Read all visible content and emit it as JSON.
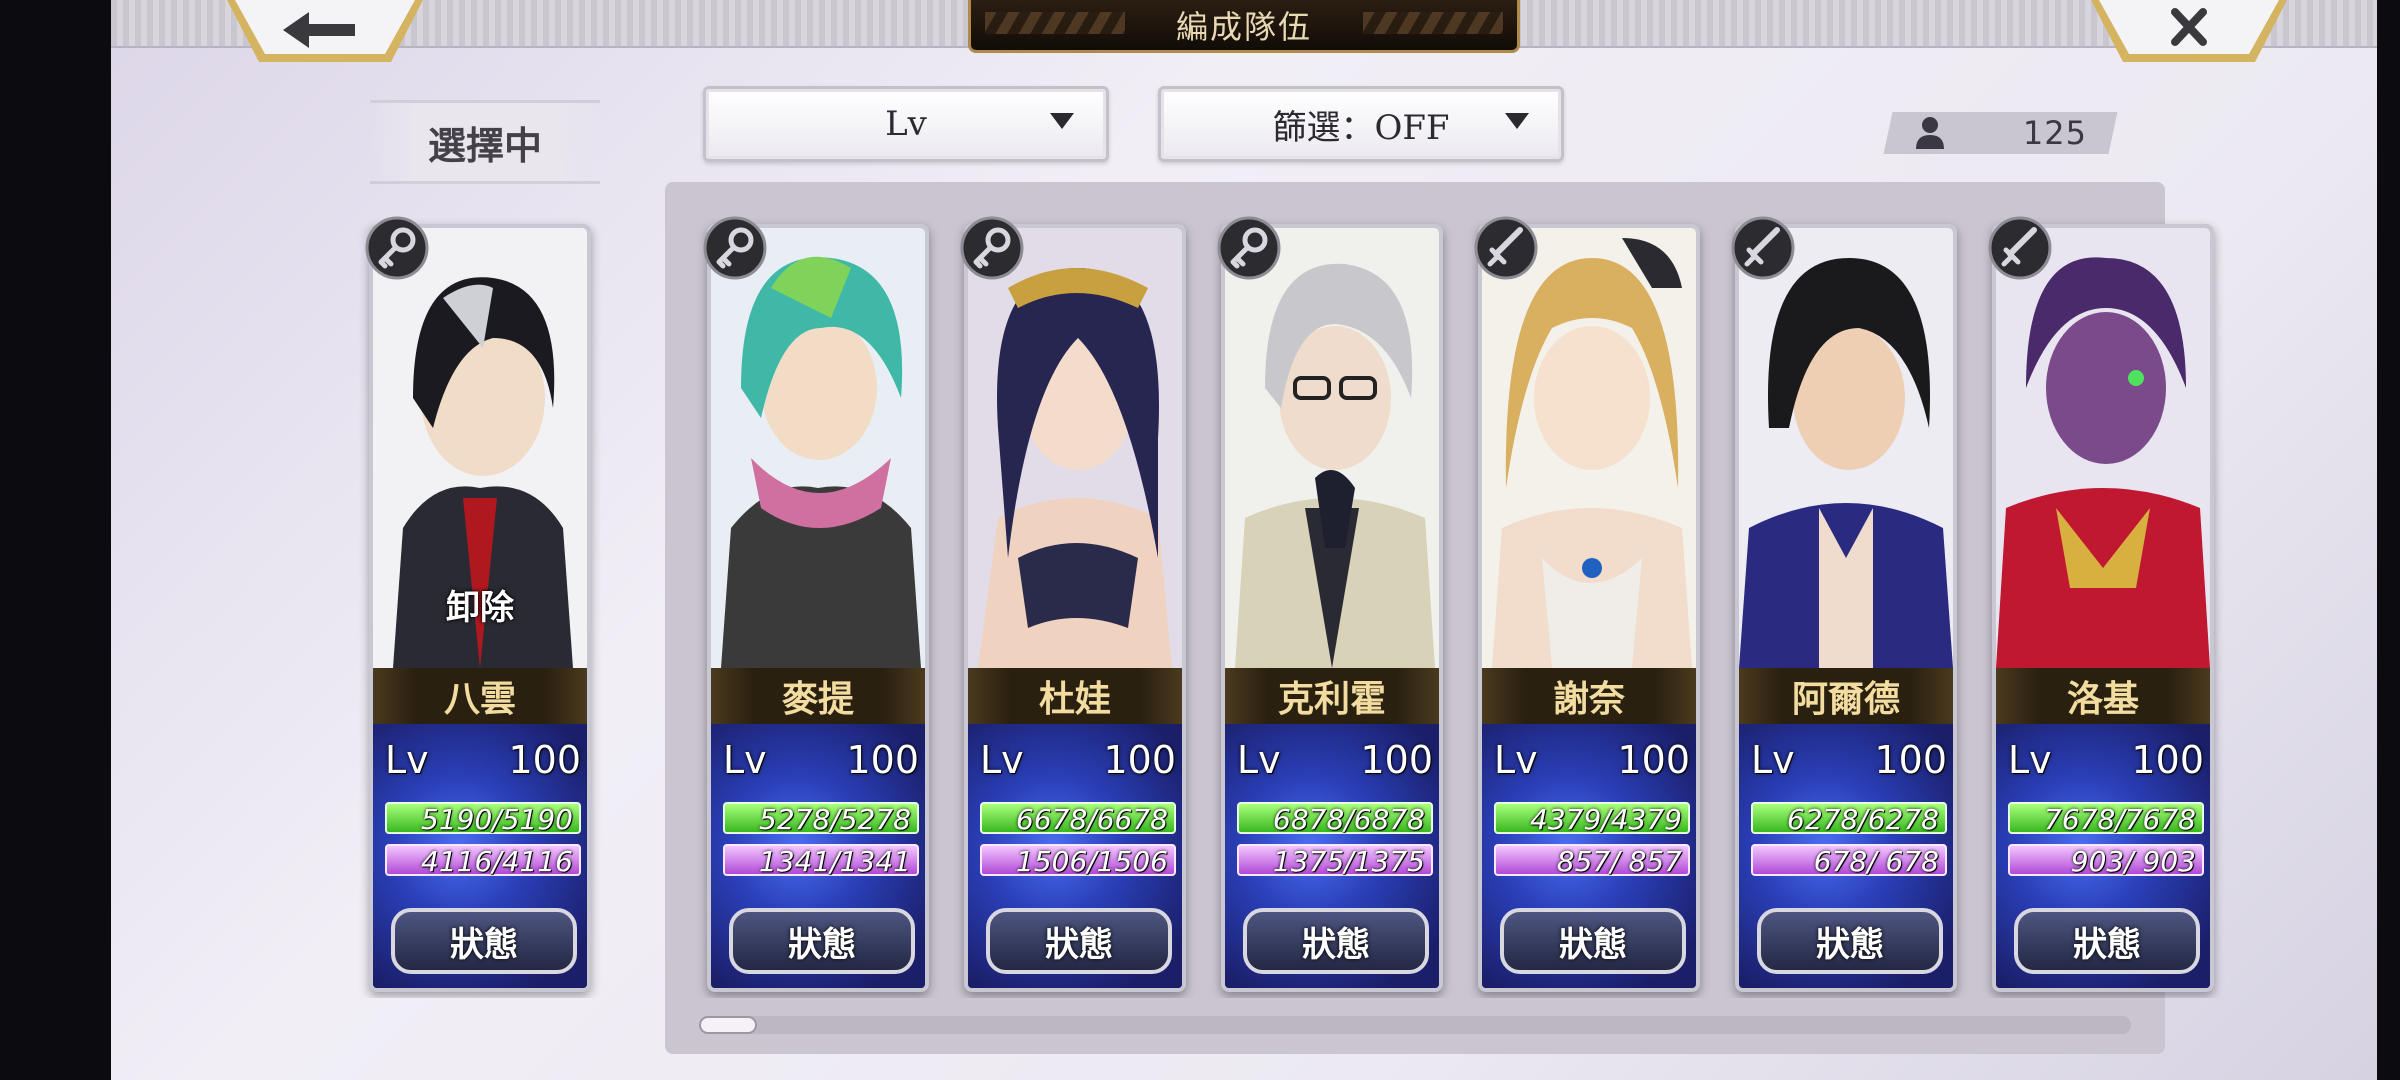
{
  "header": {
    "title": "編成隊伍"
  },
  "selected_label": "選擇中",
  "sort_dropdown": {
    "value": "Lv"
  },
  "filter_dropdown": {
    "value": "篩選：OFF"
  },
  "unit_count": "125",
  "remove_label": "卸除",
  "status_label": "狀態",
  "lv_label": "Lv",
  "selected_unit": {
    "name": "八雲",
    "level": "100",
    "hp": "5190/5190",
    "mp": "4116/4116",
    "role": "key"
  },
  "units": [
    {
      "name": "麥提",
      "level": "100",
      "hp": "5278/5278",
      "mp": "1341/1341",
      "role": "key"
    },
    {
      "name": "杜娃",
      "level": "100",
      "hp": "6678/6678",
      "mp": "1506/1506",
      "role": "key"
    },
    {
      "name": "克利霍",
      "level": "100",
      "hp": "6878/6878",
      "mp": "1375/1375",
      "role": "key"
    },
    {
      "name": "謝奈",
      "level": "100",
      "hp": "4379/4379",
      "mp": "857/ 857",
      "role": "sword"
    },
    {
      "name": "阿爾德",
      "level": "100",
      "hp": "6278/6278",
      "mp": "678/ 678",
      "role": "sword"
    },
    {
      "name": "洛基",
      "level": "100",
      "hp": "7678/7678",
      "mp": "903/ 903",
      "role": "sword"
    }
  ],
  "scroll_position": 0.0
}
